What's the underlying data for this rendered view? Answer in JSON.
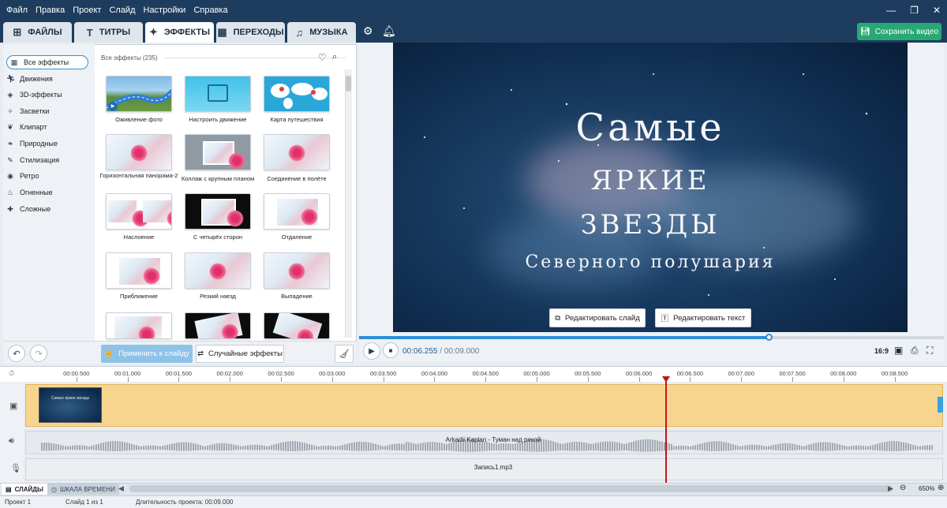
{
  "menu": [
    "Файл",
    "Правка",
    "Проект",
    "Слайд",
    "Настройки",
    "Справка"
  ],
  "window_controls": {
    "minimize": "—",
    "maximize": "❐",
    "close": "✕"
  },
  "tabs": [
    {
      "label": "ФАЙЛЫ",
      "icon": "files-icon"
    },
    {
      "label": "ТИТРЫ",
      "icon": "titles-icon"
    },
    {
      "label": "ЭФФЕКТЫ",
      "icon": "effects-icon"
    },
    {
      "label": "ПЕРЕХОДЫ",
      "icon": "transitions-icon"
    },
    {
      "label": "МУЗЫКА",
      "icon": "music-icon"
    }
  ],
  "save_button": "Сохранить видео",
  "categories": [
    "Все эффекты",
    "Движения",
    "3D-эффекты",
    "Засветки",
    "Клипарт",
    "Природные",
    "Стилизация",
    "Ретро",
    "Огненные",
    "Сложные"
  ],
  "effects_header": "Все эффекты (235)",
  "effects": [
    "Оживление фото",
    "Настроить движение",
    "Карта путешествия",
    "Горизонтальная панорама-2",
    "Коллаж с крупным планом",
    "Соединение в полёте",
    "Наслоение",
    "С четырёх сторон",
    "Отдаление",
    "Приближение",
    "Резкий наезд",
    "Выпадение"
  ],
  "apply_button": "Применить к слайду",
  "random_button": "Случайные эффекты",
  "slide": {
    "line1": "Самые",
    "line2": "яркие",
    "line3": "звезды",
    "subtitle": "Северного полушария"
  },
  "edit_slide_button": "Редактировать слайд",
  "edit_text_button": "Редактировать текст",
  "player": {
    "current": "00:06.255",
    "total": "/ 00:09.000",
    "progress": 0.7,
    "ratio": "16:9"
  },
  "ruler": [
    "00:00.500",
    "00:01.000",
    "00:01.500",
    "00:02.000",
    "00:02.500",
    "00:03.000",
    "00:03.500",
    "00:04.000",
    "00:04.500",
    "00:05.000",
    "00:05.500",
    "00:06.000",
    "00:06.500",
    "00:07.000",
    "00:07.500",
    "00:08.000",
    "00:08.500"
  ],
  "slide_thumb_text": "Самые яркие звезды",
  "audio_track": "Arkadii Kaplan - Туман над рекой",
  "record_track": "Запись1.mp3",
  "bottom_tabs": {
    "slides": "СЛАЙДЫ",
    "timeline": "ШКАЛА ВРЕМЕНИ"
  },
  "zoom": "650%",
  "status": {
    "project": "Проект 1",
    "slide": "Слайд 1 из 1",
    "duration": "Длительность проекта: 00:09.000"
  },
  "colors": {
    "titlebar": "#1d3c5e",
    "save": "#28a874",
    "accent": "#2c8fd6",
    "playhead": "#c0171c",
    "video_track": "#f7d58f"
  }
}
